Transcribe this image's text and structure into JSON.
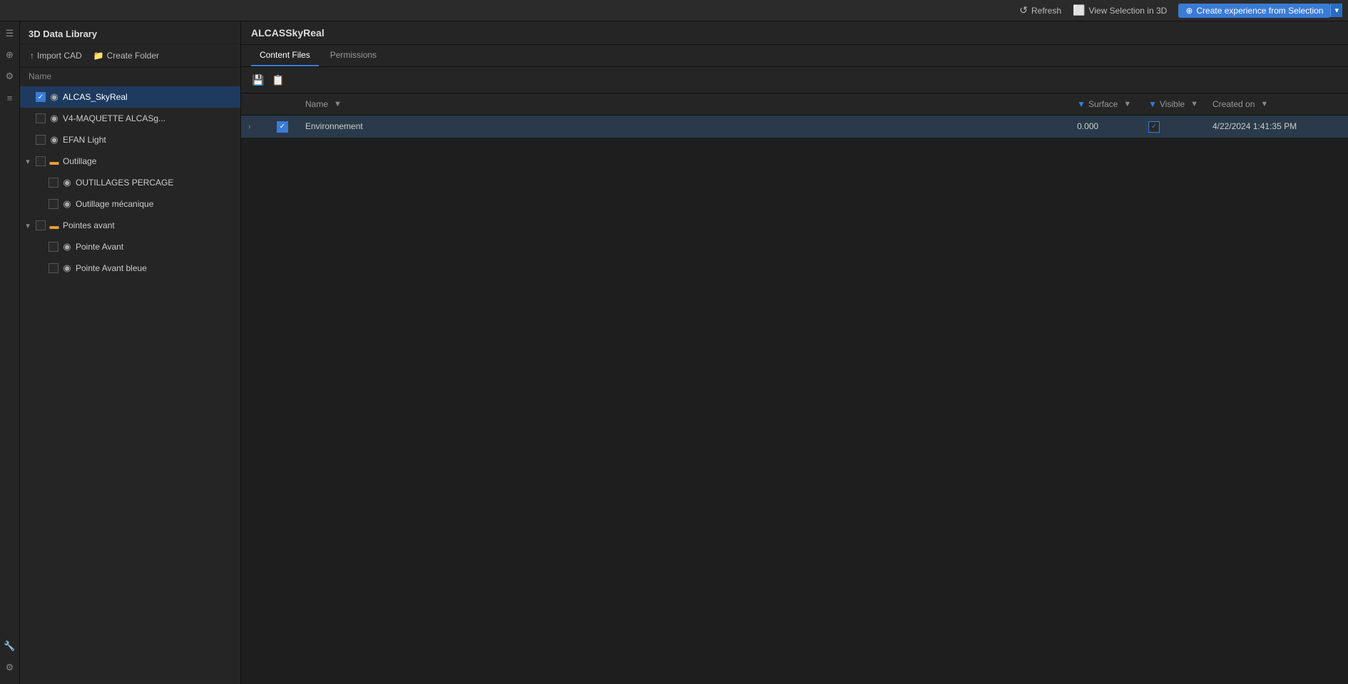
{
  "topbar": {
    "refresh_label": "Refresh",
    "view_selection_label": "View Selection in 3D",
    "create_exp_label": "Create experience from Selection",
    "chevron": "▾"
  },
  "left_panel": {
    "title": "3D Data Library",
    "import_cad_label": "Import CAD",
    "create_folder_label": "Create Folder",
    "name_col_label": "Name",
    "tree_items": [
      {
        "id": "alcas",
        "label": "ALCAS_SkyReal",
        "type": "doc",
        "indent": 0,
        "checked": true,
        "selected": true,
        "expander": ""
      },
      {
        "id": "v4",
        "label": "V4-MAQUETTE ALCASg...",
        "type": "doc",
        "indent": 0,
        "checked": false,
        "selected": false,
        "expander": ""
      },
      {
        "id": "efan",
        "label": "EFAN Light",
        "type": "doc",
        "indent": 0,
        "checked": false,
        "selected": false,
        "expander": ""
      },
      {
        "id": "outillage",
        "label": "Outillage",
        "type": "folder",
        "indent": 0,
        "checked": false,
        "selected": false,
        "expander": "▾"
      },
      {
        "id": "outillages_percage",
        "label": "OUTILLAGES PERCAGE",
        "type": "doc",
        "indent": 1,
        "checked": false,
        "selected": false,
        "expander": ""
      },
      {
        "id": "outillage_mec",
        "label": "Outillage mécanique",
        "type": "doc",
        "indent": 1,
        "checked": false,
        "selected": false,
        "expander": ""
      },
      {
        "id": "pointes_avant",
        "label": "Pointes avant",
        "type": "folder",
        "indent": 0,
        "checked": false,
        "selected": false,
        "expander": "▾"
      },
      {
        "id": "pointe_avant",
        "label": "Pointe Avant",
        "type": "doc",
        "indent": 1,
        "checked": false,
        "selected": false,
        "expander": ""
      },
      {
        "id": "pointe_avant_bleue",
        "label": "Pointe Avant bleue",
        "type": "doc",
        "indent": 1,
        "checked": false,
        "selected": false,
        "expander": ""
      }
    ]
  },
  "right_panel": {
    "title": "ALCASSkyReal",
    "tabs": [
      {
        "id": "content",
        "label": "Content Files",
        "active": true
      },
      {
        "id": "permissions",
        "label": "Permissions",
        "active": false
      }
    ],
    "table_headers": {
      "name": "Name",
      "surface": "Surface",
      "visible": "Visible",
      "created_on": "Created on"
    },
    "rows": [
      {
        "id": "env",
        "name": "Environnement",
        "surface": "0.000",
        "visible": true,
        "created_on": "4/22/2024 1:41:35 PM",
        "checked": true,
        "expanded": false
      }
    ]
  },
  "sidebar_icons": [
    "☰",
    "⊕",
    "⚙",
    "☰"
  ],
  "sidebar_bottom_icons": [
    "🔧",
    "⚙"
  ]
}
